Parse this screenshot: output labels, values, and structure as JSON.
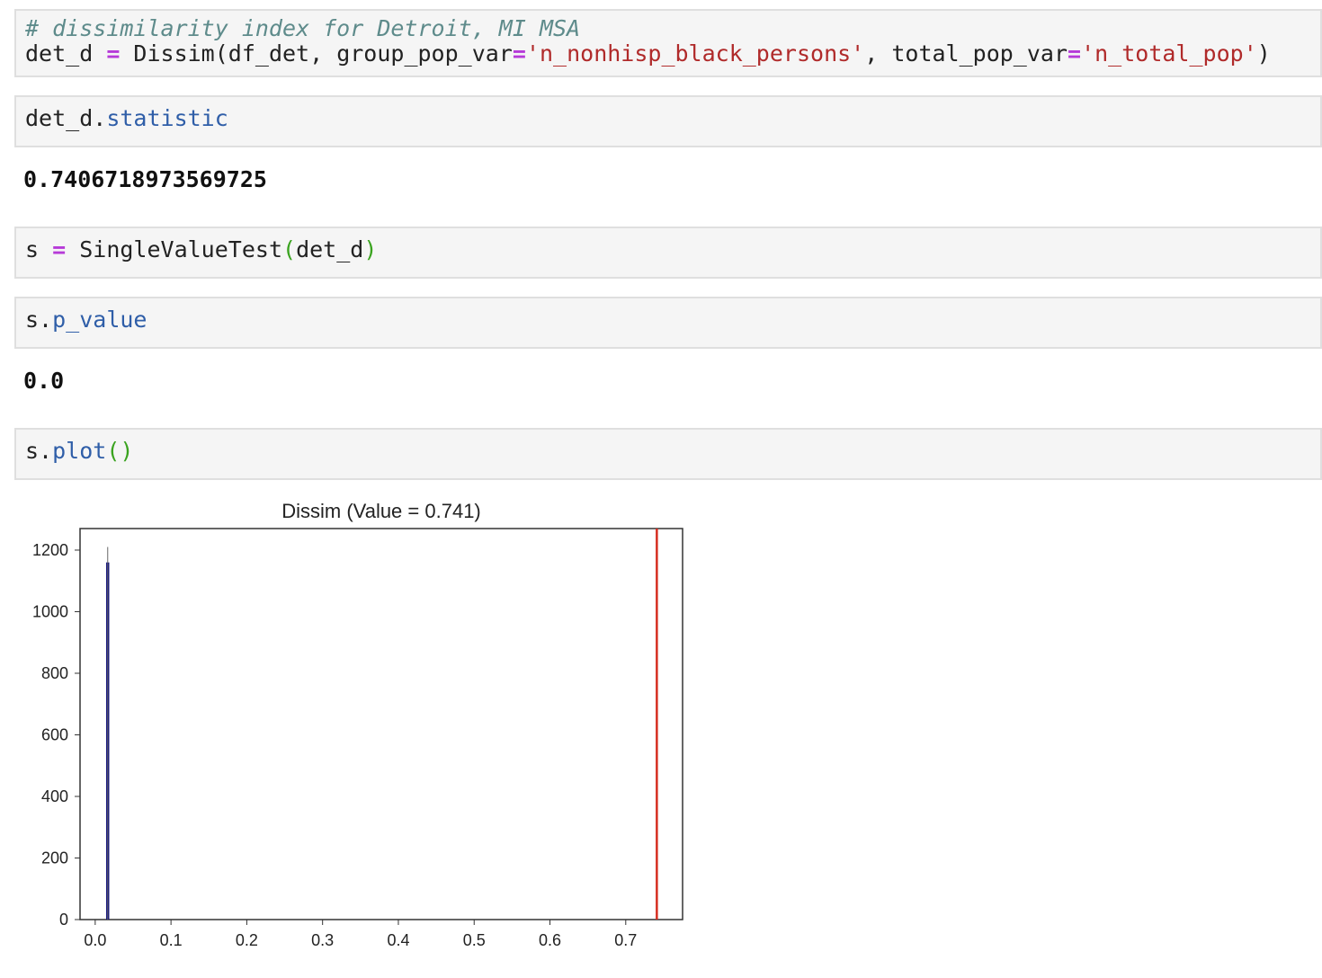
{
  "cells": [
    {
      "comment": "# dissimilarity index for Detroit, MI MSA",
      "code_parts": [
        "det_d ",
        "=",
        " Dissim(df_det, group_pop_var",
        "=",
        "'n_nonhisp_black_persons'",
        ", total_pop_var",
        "=",
        "'n_total_pop'",
        ")"
      ]
    },
    {
      "code_parts": [
        "det_d.",
        "statistic"
      ],
      "output": "0.7406718973569725"
    },
    {
      "code_parts": [
        "s ",
        "=",
        " SingleValueTest",
        "(",
        "det_d",
        ")"
      ]
    },
    {
      "code_parts": [
        "s.",
        "p_value"
      ],
      "output": "0.0"
    },
    {
      "code_parts": [
        "s.",
        "plot",
        "()"
      ]
    }
  ],
  "colors": {
    "comment": "#5e8b8b",
    "operator": "#b63ad8",
    "string": "#b02a2a",
    "attribute": "#2f5ea8",
    "paren": "#3aa31f",
    "histogram": "#0a0a7a",
    "observed_line": "#d62d20"
  },
  "chart_data": {
    "type": "bar",
    "title": "Dissim (Value = 0.741)",
    "xlabel": "",
    "ylabel": "",
    "xlim": [
      -0.02,
      0.775
    ],
    "ylim": [
      0,
      1270
    ],
    "xticks": [
      "0.0",
      "0.1",
      "0.2",
      "0.3",
      "0.4",
      "0.5",
      "0.6",
      "0.7"
    ],
    "yticks": [
      "0",
      "200",
      "400",
      "600",
      "800",
      "1000",
      "1200"
    ],
    "histogram": {
      "x_start": 0.0145,
      "x_end": 0.0185,
      "peak": 1160,
      "kde_max": 1210
    },
    "observed_value": 0.741,
    "grid": false
  }
}
